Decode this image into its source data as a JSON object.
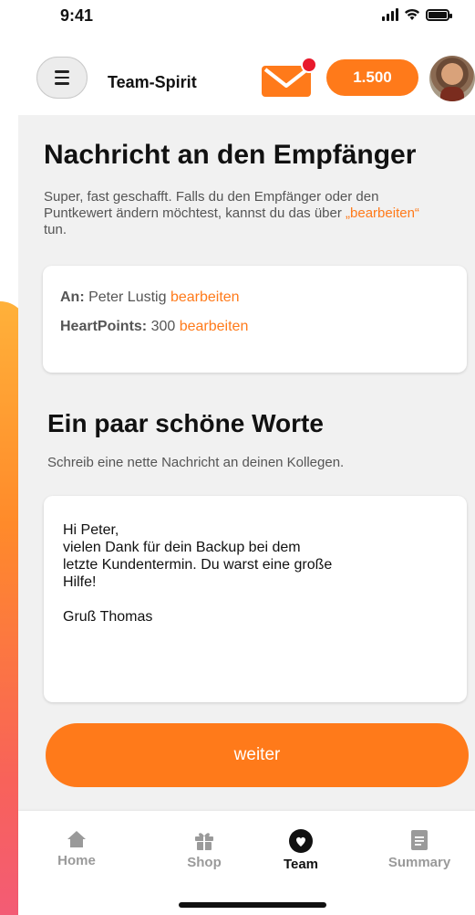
{
  "status_bar": {
    "time": "9:41"
  },
  "header": {
    "title": "Team-Spirit",
    "points": "1.500",
    "has_notification": true
  },
  "main": {
    "heading": "Nachricht an den Empfänger",
    "intro_prefix": "Super, fast geschafft. Falls du den Empfänger oder den Puntkewert ändern möchtest, kannst du das über ",
    "intro_link": "„bearbeiten“",
    "intro_suffix": " tun.",
    "recipient": {
      "to_label": "An:",
      "to_value": "Peter Lustig",
      "points_label": "HeartPoints:",
      "points_value": "300",
      "edit_label": "bearbeiten"
    },
    "heading2": "Ein paar schöne Worte",
    "subheading": "Schreib eine nette Nachricht an deinen Kollegen.",
    "message": "Hi Peter,\nvielen Dank für dein Backup bei dem\nletzte Kundentermin. Du warst eine große\nHilfe!\n\nGruß Thomas",
    "cta_label": "weiter"
  },
  "tabs": [
    {
      "label": "Home",
      "icon": "home-icon",
      "active": false
    },
    {
      "label": "Shop",
      "icon": "gift-icon",
      "active": false
    },
    {
      "label": "Team",
      "icon": "heart-icon",
      "active": true
    },
    {
      "label": "Summary",
      "icon": "document-icon",
      "active": false
    }
  ],
  "colors": {
    "accent": "#ff7a1a",
    "notification": "#e8192c",
    "panel_bg": "#f1f1f1"
  }
}
